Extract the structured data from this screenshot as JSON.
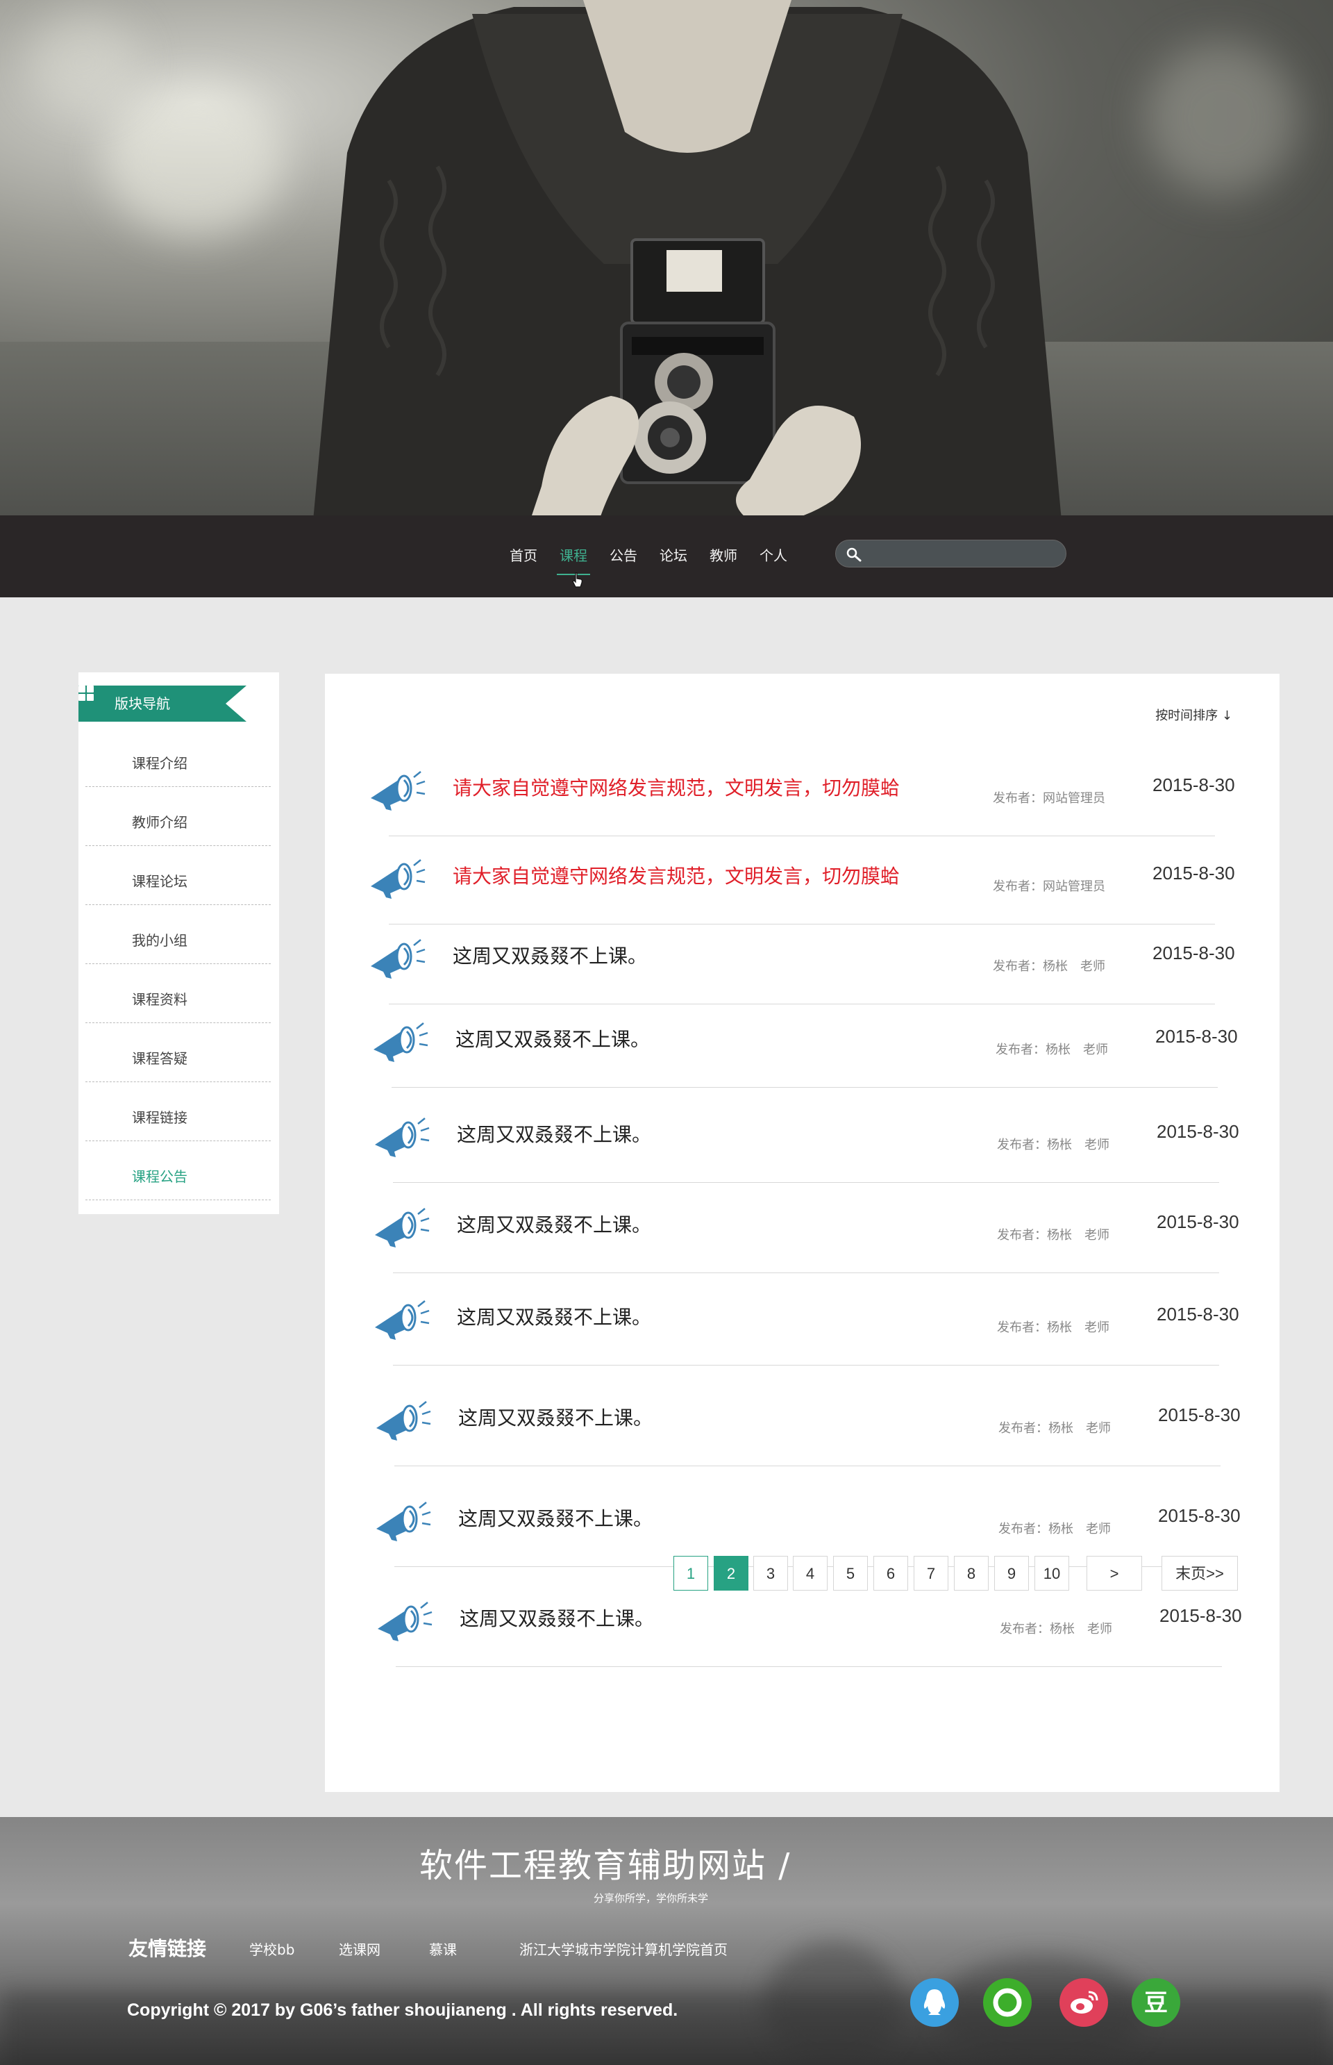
{
  "nav": {
    "items": [
      "首页",
      "课程",
      "公告",
      "论坛",
      "教师",
      "个人"
    ],
    "active_index": 1,
    "search_placeholder": ""
  },
  "sidebar": {
    "title": "版块导航",
    "items": [
      "课程介绍",
      "教师介绍",
      "课程论坛",
      "我的小组",
      "课程资料",
      "课程答疑",
      "课程链接",
      "课程公告"
    ],
    "active_index": 7
  },
  "main": {
    "sort_label": "按时间排序 ↓",
    "notices": [
      {
        "title": "请大家自觉遵守网络发言规范，文明发言，切勿膜蛤",
        "publisher": "发布者：网站管理员",
        "date": "2015-8-30",
        "highlight": true
      },
      {
        "title": "请大家自觉遵守网络发言规范，文明发言，切勿膜蛤",
        "publisher": "发布者：网站管理员",
        "date": "2015-8-30",
        "highlight": true
      },
      {
        "title": "这周又双叒叕不上课。",
        "publisher": "发布者：杨枨　老师",
        "date": "2015-8-30",
        "highlight": false
      },
      {
        "title": "这周又双叒叕不上课。",
        "publisher": "发布者：杨枨　老师",
        "date": "2015-8-30",
        "highlight": false
      },
      {
        "title": "这周又双叒叕不上课。",
        "publisher": "发布者：杨枨　老师",
        "date": "2015-8-30",
        "highlight": false
      },
      {
        "title": "这周又双叒叕不上课。",
        "publisher": "发布者：杨枨　老师",
        "date": "2015-8-30",
        "highlight": false
      },
      {
        "title": "这周又双叒叕不上课。",
        "publisher": "发布者：杨枨　老师",
        "date": "2015-8-30",
        "highlight": false
      },
      {
        "title": "这周又双叒叕不上课。",
        "publisher": "发布者：杨枨　老师",
        "date": "2015-8-30",
        "highlight": false
      },
      {
        "title": "这周又双叒叕不上课。",
        "publisher": "发布者：杨枨　老师",
        "date": "2015-8-30",
        "highlight": false
      },
      {
        "title": "这周又双叒叕不上课。",
        "publisher": "发布者：杨枨　老师",
        "date": "2015-8-30",
        "highlight": false
      }
    ],
    "pagination": {
      "pages": [
        "1",
        "2",
        "3",
        "4",
        "5",
        "6",
        "7",
        "8",
        "9",
        "10"
      ],
      "current_page": "2",
      "next_label": ">",
      "last_label": "末页>>"
    }
  },
  "footer": {
    "site_title": "软件工程教育辅助网站 /",
    "slogan": "分享你所学，学你所未学",
    "links_label": "友情链接",
    "links": [
      "学校bb",
      "选课网",
      "慕课",
      "浙江大学城市学院计算机学院首页"
    ],
    "copyright": "Copyright © 2017 by G06’s father shoujianeng . All rights reserved.",
    "social": [
      {
        "name": "qq",
        "color": "#3aa0e0"
      },
      {
        "name": "wechat-moments",
        "color": "#3dae2b"
      },
      {
        "name": "weibo",
        "color": "#e0405a"
      },
      {
        "name": "douban",
        "color": "#3aa83a"
      }
    ]
  },
  "colors": {
    "accent": "#27a283",
    "nav_bg": "#2a2627",
    "highlight_red": "#e0202a",
    "icon_blue": "#3b83b8"
  }
}
